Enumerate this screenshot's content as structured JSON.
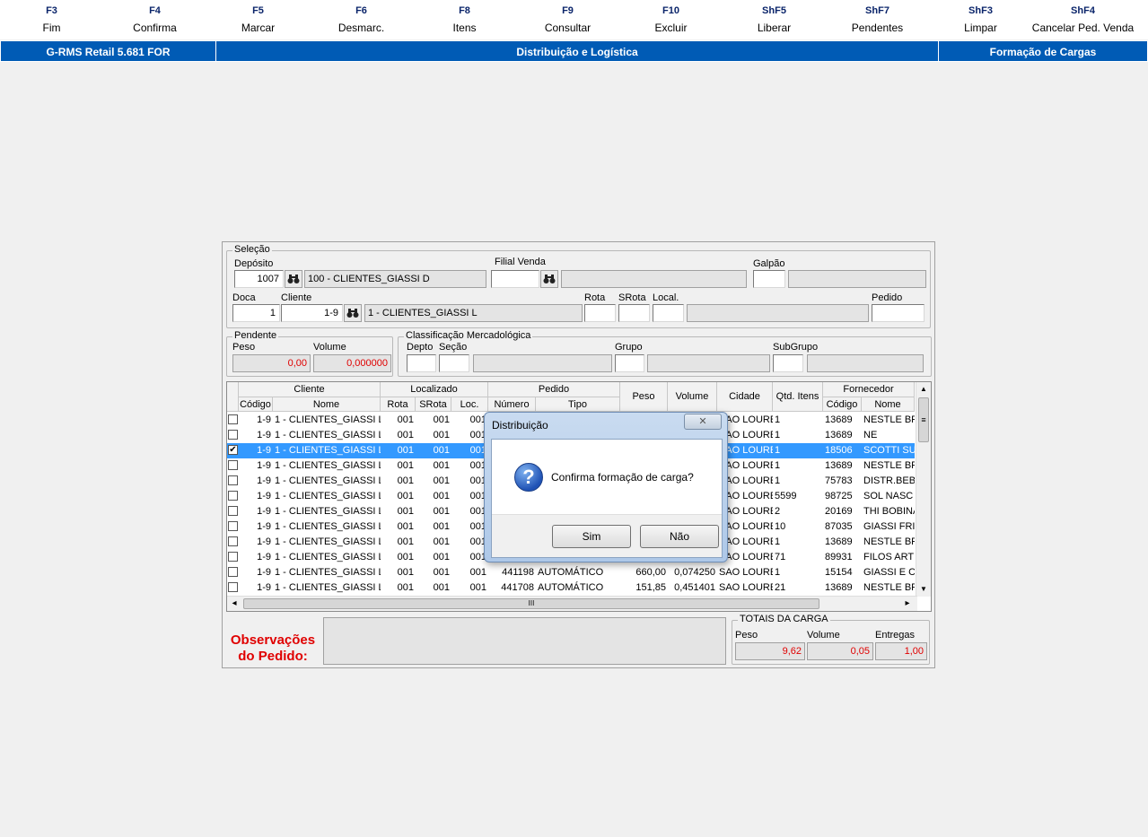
{
  "function_keys": [
    {
      "key": "F3",
      "label": "Fim"
    },
    {
      "key": "F4",
      "label": "Confirma"
    },
    {
      "key": "F5",
      "label": "Marcar"
    },
    {
      "key": "F6",
      "label": "Desmarc."
    },
    {
      "key": "F8",
      "label": "Itens"
    },
    {
      "key": "F9",
      "label": "Consultar"
    },
    {
      "key": "F10",
      "label": "Excluir"
    },
    {
      "key": "ShF5",
      "label": "Liberar"
    },
    {
      "key": "ShF7",
      "label": "Pendentes"
    },
    {
      "key": "ShF3",
      "label": "Limpar"
    },
    {
      "key": "ShF4",
      "label": "Cancelar Ped. Venda"
    }
  ],
  "titlebar": {
    "app": "G-RMS Retail 5.681 FOR",
    "module": "Distribuição e Logística",
    "screen": "Formação de Cargas"
  },
  "selecao": {
    "title": "Seleção",
    "deposito_label": "Depósito",
    "deposito_value": "1007",
    "deposito_desc": "100 - CLIENTES_GIASSI D",
    "filial_label": "Filial Venda",
    "filial_value": "",
    "filial_desc": "",
    "galpao_label": "Galpão",
    "galpao_value": "",
    "galpao_desc": "",
    "doca_label": "Doca",
    "doca_value": "1",
    "cliente_label": "Cliente",
    "cliente_value": "1-9",
    "cliente_desc": "1 - CLIENTES_GIASSI L",
    "rota_label": "Rota",
    "rota_value": "",
    "srota_label": "SRota",
    "srota_value": "",
    "local_label": "Local.",
    "local_value": "",
    "local_desc": "",
    "pedido_label": "Pedido",
    "pedido_value": ""
  },
  "pendente": {
    "title": "Pendente",
    "peso_label": "Peso",
    "peso_value": "0,00",
    "volume_label": "Volume",
    "volume_value": "0,000000"
  },
  "classificacao": {
    "title": "Classificação Mercadológica",
    "depto_label": "Depto",
    "secao_label": "Seção",
    "grupo_label": "Grupo",
    "subgrupo_label": "SubGrupo"
  },
  "grid": {
    "group_headers": {
      "cliente": "Cliente",
      "localizado": "Localizado",
      "pedido": "Pedido",
      "peso": "Peso",
      "volume": "Volume",
      "cidade": "Cidade",
      "qtd": "Qtd. Itens",
      "fornecedor": "Fornecedor"
    },
    "sub_headers": {
      "codigo": "Código",
      "nome": "Nome",
      "rota": "Rota",
      "srota": "SRota",
      "loc": "Loc.",
      "numero": "Número",
      "tipo": "Tipo",
      "forn_codigo": "Código",
      "forn_nome": "Nome"
    },
    "rows": [
      {
        "checked": "",
        "codigo": "1-9",
        "nome": "1 - CLIENTES_GIASSI L",
        "rota": "001",
        "srota": "001",
        "loc": "001",
        "numero": "",
        "tipo": "",
        "peso": "",
        "volume": "",
        "cidade": "SAO LOURE",
        "qtd": "1",
        "forn_cod": "13689",
        "forn_nome": "NESTLE BR"
      },
      {
        "checked": "",
        "codigo": "1-9",
        "nome": "1 - CLIENTES_GIASSI L",
        "rota": "001",
        "srota": "001",
        "loc": "001",
        "numero": "",
        "tipo": "",
        "peso": "",
        "volume": "",
        "cidade": "SAO LOURE",
        "qtd": "1",
        "forn_cod": "13689",
        "forn_nome": "NE"
      },
      {
        "checked": "✔",
        "codigo": "1-9",
        "nome": "1 - CLIENTES_GIASSI L",
        "rota": "001",
        "srota": "001",
        "loc": "001",
        "numero": "",
        "tipo": "",
        "peso": "",
        "volume": "",
        "cidade": "SAO LOURE",
        "qtd": "1",
        "forn_cod": "18506",
        "forn_nome": "SCOTTI SU"
      },
      {
        "checked": "",
        "codigo": "1-9",
        "nome": "1 - CLIENTES_GIASSI L",
        "rota": "001",
        "srota": "001",
        "loc": "001",
        "numero": "",
        "tipo": "",
        "peso": "",
        "volume": "",
        "cidade": "SAO LOURE",
        "qtd": "1",
        "forn_cod": "13689",
        "forn_nome": "NESTLE BR"
      },
      {
        "checked": "",
        "codigo": "1-9",
        "nome": "1 - CLIENTES_GIASSI L",
        "rota": "001",
        "srota": "001",
        "loc": "001",
        "numero": "",
        "tipo": "",
        "peso": "",
        "volume": "",
        "cidade": "SAO LOURE",
        "qtd": "1",
        "forn_cod": "75783",
        "forn_nome": "DISTR.BEB"
      },
      {
        "checked": "",
        "codigo": "1-9",
        "nome": "1 - CLIENTES_GIASSI L",
        "rota": "001",
        "srota": "001",
        "loc": "001",
        "numero": "",
        "tipo": "",
        "peso": "",
        "volume": "",
        "cidade": "SAO LOURE",
        "qtd": "5599",
        "forn_cod": "98725",
        "forn_nome": "SOL NASC"
      },
      {
        "checked": "",
        "codigo": "1-9",
        "nome": "1 - CLIENTES_GIASSI L",
        "rota": "001",
        "srota": "001",
        "loc": "001",
        "numero": "",
        "tipo": "",
        "peso": "",
        "volume": "",
        "cidade": "SAO LOURE",
        "qtd": "2",
        "forn_cod": "20169",
        "forn_nome": "THI BOBINA"
      },
      {
        "checked": "",
        "codigo": "1-9",
        "nome": "1 - CLIENTES_GIASSI L",
        "rota": "001",
        "srota": "001",
        "loc": "001",
        "numero": "",
        "tipo": "",
        "peso": "",
        "volume": "",
        "cidade": "SAO LOURE",
        "qtd": "10",
        "forn_cod": "87035",
        "forn_nome": "GIASSI FRI"
      },
      {
        "checked": "",
        "codigo": "1-9",
        "nome": "1 - CLIENTES_GIASSI L",
        "rota": "001",
        "srota": "001",
        "loc": "001",
        "numero": "",
        "tipo": "",
        "peso": "",
        "volume": "",
        "cidade": "SAO LOURE",
        "qtd": "1",
        "forn_cod": "13689",
        "forn_nome": "NESTLE BR"
      },
      {
        "checked": "",
        "codigo": "1-9",
        "nome": "1 - CLIENTES_GIASSI L",
        "rota": "001",
        "srota": "001",
        "loc": "001",
        "numero": "",
        "tipo": "",
        "peso": "",
        "volume": "",
        "cidade": "SAO LOURE",
        "qtd": "71",
        "forn_cod": "89931",
        "forn_nome": "FILOS ART"
      },
      {
        "checked": "",
        "codigo": "1-9",
        "nome": "1 - CLIENTES_GIASSI L",
        "rota": "001",
        "srota": "001",
        "loc": "001",
        "numero": "441198",
        "tipo": "AUTOMÁTICO",
        "peso": "660,00",
        "volume": "0,074250",
        "cidade": "SAO LOURE",
        "qtd": "1",
        "forn_cod": "15154",
        "forn_nome": "GIASSI E C"
      },
      {
        "checked": "",
        "codigo": "1-9",
        "nome": "1 - CLIENTES_GIASSI L",
        "rota": "001",
        "srota": "001",
        "loc": "001",
        "numero": "441708",
        "tipo": "AUTOMÁTICO",
        "peso": "151,85",
        "volume": "0,451401",
        "cidade": "SAO LOURE",
        "qtd": "21",
        "forn_cod": "13689",
        "forn_nome": "NESTLE BR"
      }
    ],
    "selected_row": 2,
    "scroll_up": "▲",
    "scroll_down": "▼",
    "scroll_left": "◂",
    "scroll_right": "▸",
    "hscroll_grip": "III",
    "vscroll_grip": "≡"
  },
  "observacoes": {
    "label_line1": "Observações",
    "label_line2": "do Pedido:",
    "value": ""
  },
  "totais": {
    "title": "TOTAIS DA CARGA",
    "peso_label": "Peso",
    "peso_value": "9,62",
    "volume_label": "Volume",
    "volume_value": "0,05",
    "entregas_label": "Entregas",
    "entregas_value": "1,00"
  },
  "dialog": {
    "title": "Distribuição",
    "close_glyph": "✕",
    "icon": "question-icon",
    "icon_glyph": "?",
    "message": "Confirma formação de carga?",
    "yes_label": "Sim",
    "no_label": "Não"
  },
  "colors": {
    "titlebar_blue": "#005bb5",
    "selection_blue": "#3399ff",
    "alert_red": "#e00000"
  }
}
